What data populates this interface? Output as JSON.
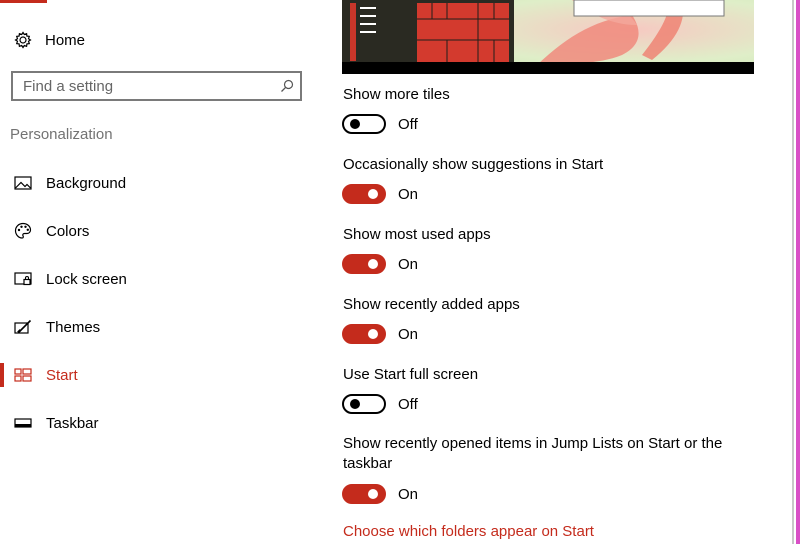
{
  "sidebar": {
    "home": {
      "label": "Home",
      "icon": "gear-icon"
    },
    "search": {
      "placeholder": "Find a setting",
      "value": "",
      "icon": "search-icon"
    },
    "section_title": "Personalization",
    "items": [
      {
        "label": "Background",
        "icon": "image-icon",
        "active": false
      },
      {
        "label": "Colors",
        "icon": "palette-icon",
        "active": false
      },
      {
        "label": "Lock screen",
        "icon": "lock-screen-icon",
        "active": false
      },
      {
        "label": "Themes",
        "icon": "themes-brush-icon",
        "active": false
      },
      {
        "label": "Start",
        "icon": "start-tiles-icon",
        "active": true
      },
      {
        "label": "Taskbar",
        "icon": "taskbar-icon",
        "active": false
      }
    ]
  },
  "settings": [
    {
      "label": "Show more tiles",
      "state": "Off",
      "on": false
    },
    {
      "label": "Occasionally show suggestions in Start",
      "state": "On",
      "on": true
    },
    {
      "label": "Show most used apps",
      "state": "On",
      "on": true
    },
    {
      "label": "Show recently added apps",
      "state": "On",
      "on": true
    },
    {
      "label": "Use Start full screen",
      "state": "Off",
      "on": false
    },
    {
      "label": "Show recently opened items in Jump Lists on Start or the taskbar",
      "label_line1": "Show recently opened items in Jump Lists on Start or the",
      "label_line2": "taskbar",
      "state": "On",
      "on": true
    }
  ],
  "link": {
    "label": "Choose which folders appear on Start"
  },
  "colors": {
    "accent": "#c42b1c",
    "preview_tiles": "#d33a2e",
    "preview_dark": "#2a2a22",
    "window_edge": "#d94fc6"
  }
}
